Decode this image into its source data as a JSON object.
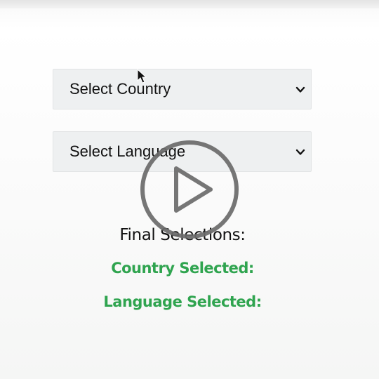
{
  "country_select": {
    "selected": "Select Country",
    "chevron": "chevron-down-icon"
  },
  "language_select": {
    "selected": "Select Language",
    "chevron": "chevron-down-icon"
  },
  "results": {
    "heading": "Final Selections:",
    "country_label": "Country Selected:",
    "language_label": "Language Selected:"
  },
  "video": {
    "icon": "play-icon"
  },
  "colors": {
    "accent": "#2fa44f",
    "select_bg": "#eef0f1",
    "play_overlay": "#6a6a6a"
  }
}
